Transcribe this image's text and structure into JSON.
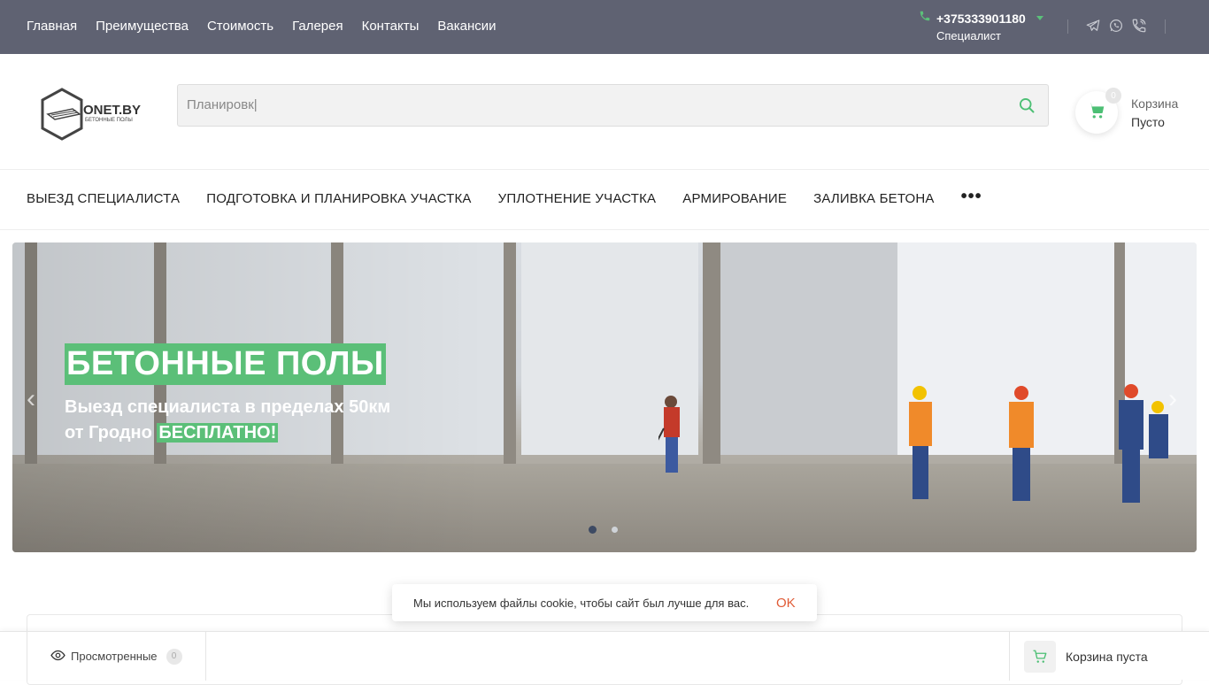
{
  "topnav": {
    "items": [
      "Главная",
      "Преимущества",
      "Стоимость",
      "Галерея",
      "Контакты",
      "Вакансии"
    ]
  },
  "contact": {
    "phone": "+375333901180",
    "role": "Специалист"
  },
  "social_icons": [
    "telegram-icon",
    "whatsapp-icon",
    "viber-icon"
  ],
  "logo": {
    "name": "ONET.BY",
    "tagline": "БЕТОННЫЕ ПОЛЫ"
  },
  "search": {
    "value": "Планировк|"
  },
  "cart": {
    "count": "0",
    "label": "Корзина",
    "status": "Пусто"
  },
  "catnav": {
    "items": [
      "ВЫЕЗД СПЕЦИАЛИСТА",
      "ПОДГОТОВКА И ПЛАНИРОВКА УЧАСТКА",
      "УПЛОТНЕНИЕ УЧАСТКА",
      "АРМИРОВАНИЕ",
      "ЗАЛИВКА БЕТОНА"
    ],
    "more": "•••"
  },
  "banner": {
    "title": "БЕТОННЫЕ ПОЛЫ",
    "line1": "Выезд специалиста в пределах 50км",
    "line2_prefix": "от Гродно",
    "line2_highlight": "БЕСПЛАТНО!",
    "prev": "‹",
    "next": "›",
    "slides": 2,
    "active_slide": 1
  },
  "cookie": {
    "text": "Мы используем файлы cookie, чтобы сайт был лучше для вас.",
    "ok": "OK"
  },
  "bottombar": {
    "viewed_label": "Просмотренные",
    "viewed_count": "0",
    "cart_label": "Корзина пуста"
  },
  "colors": {
    "accent": "#5bbf78",
    "topbar": "#5f6272",
    "cookie_ok": "#e05b36"
  }
}
